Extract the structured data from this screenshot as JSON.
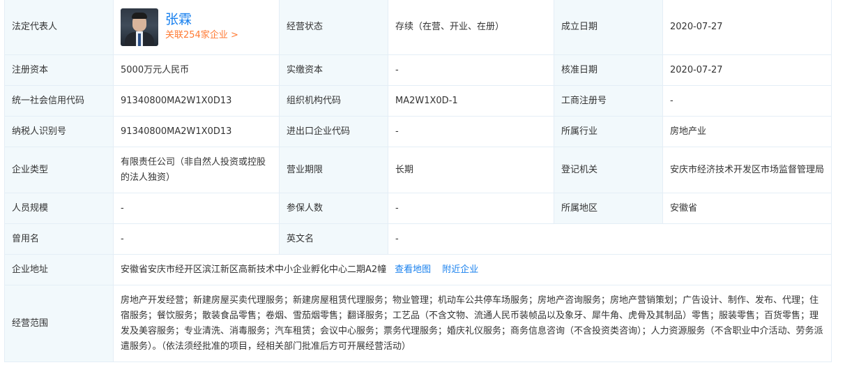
{
  "rows": {
    "legal_rep": {
      "label": "法定代表人",
      "name": "张霖",
      "related": "关联254家企业 >",
      "status_label": "经营状态",
      "status_value": "存续（在营、开业、在册）",
      "founded_label": "成立日期",
      "founded_value": "2020-07-27"
    },
    "capital": {
      "label": "注册资本",
      "value": "5000万元人民币",
      "paid_label": "实缴资本",
      "paid_value": "-",
      "approved_label": "核准日期",
      "approved_value": "2020-07-27"
    },
    "credit": {
      "label": "统一社会信用代码",
      "value": "91340800MA2W1X0D13",
      "org_label": "组织机构代码",
      "org_value": "MA2W1X0D-1",
      "reg_label": "工商注册号",
      "reg_value": "-"
    },
    "tax": {
      "label": "纳税人识别号",
      "value": "91340800MA2W1X0D13",
      "import_label": "进出口企业代码",
      "import_value": "-",
      "industry_label": "所属行业",
      "industry_value": "房地产业"
    },
    "type": {
      "label": "企业类型",
      "value": "有限责任公司（非自然人投资或控股的法人独资）",
      "term_label": "营业期限",
      "term_value": "长期",
      "authority_label": "登记机关",
      "authority_value": "安庆市经济技术开发区市场监督管理局"
    },
    "staff": {
      "label": "人员规模",
      "value": "-",
      "insured_label": "参保人数",
      "insured_value": "-",
      "region_label": "所属地区",
      "region_value": "安徽省"
    },
    "former": {
      "label": "曾用名",
      "value": "-",
      "english_label": "英文名",
      "english_value": "-"
    },
    "address": {
      "label": "企业地址",
      "value": "安徽省安庆市经开区滨江新区高新技术中小企业孵化中心二期A2幢",
      "map_link": "查看地图",
      "nearby_link": "附近企业"
    },
    "scope": {
      "label": "经营范围",
      "value": "房地产开发经营；新建房屋买卖代理服务；新建房屋租赁代理服务；物业管理；机动车公共停车场服务；房地产咨询服务；房地产营销策划；广告设计、制作、发布、代理；住宿服务；餐饮服务；散装食品零售；卷烟、雪茄烟零售；翻译服务；工艺品（不含文物、流通人民币装帧品以及象牙、犀牛角、虎骨及其制品）零售；服装零售；百货零售；理发及美容服务；专业清洗、消毒服务；汽车租赁；会议中心服务；票务代理服务；婚庆礼仪服务；商务信息咨询（不含投资类咨询）；人力资源服务（不含职业中介活动、劳务派遣服务）。（依法须经批准的项目，经相关部门批准后方可开展经营活动）"
    }
  }
}
